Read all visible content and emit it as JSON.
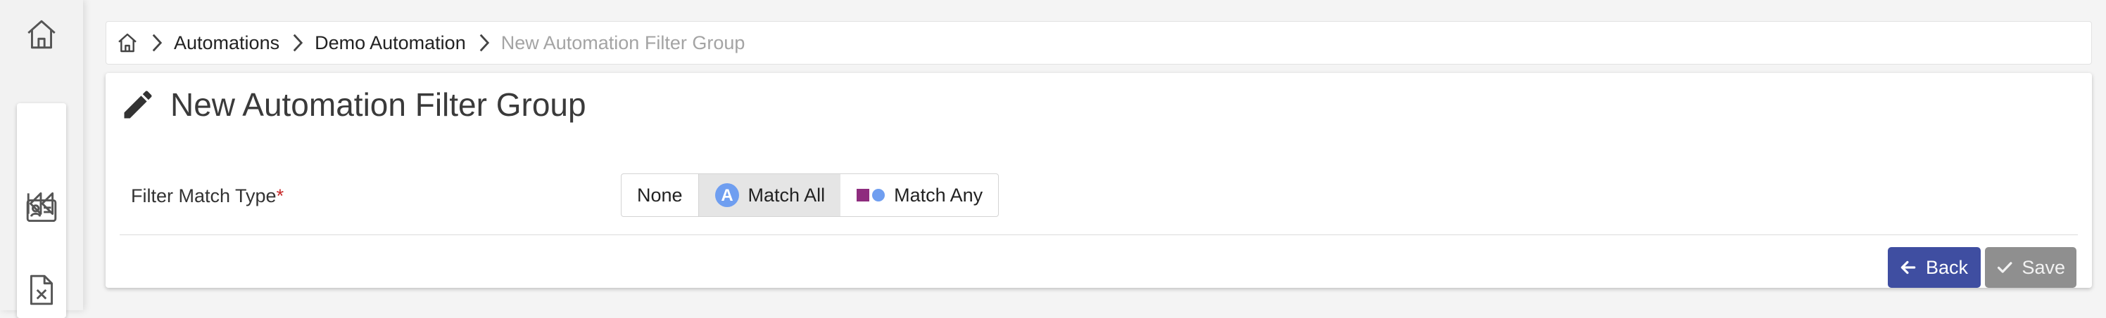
{
  "sidebar": {
    "items": [
      {
        "icon": "home-icon"
      },
      {
        "icon": "contact-card-icon"
      },
      {
        "icon": "rewind-icon"
      },
      {
        "icon": "excel-file-icon"
      }
    ]
  },
  "breadcrumb": {
    "items": [
      "Automations",
      "Demo Automation"
    ],
    "current": "New Automation Filter Group"
  },
  "page": {
    "title": "New Automation Filter Group"
  },
  "form": {
    "filter_match_type": {
      "label": "Filter Match Type",
      "required_marker": "*",
      "options": [
        "None",
        "Match All",
        "Match Any"
      ],
      "selected": "Match All"
    }
  },
  "actions": {
    "back_label": "Back",
    "save_label": "Save"
  },
  "colors": {
    "back_button": "#3f4ea1",
    "save_button": "#8f8f8f",
    "required": "#c62828"
  }
}
